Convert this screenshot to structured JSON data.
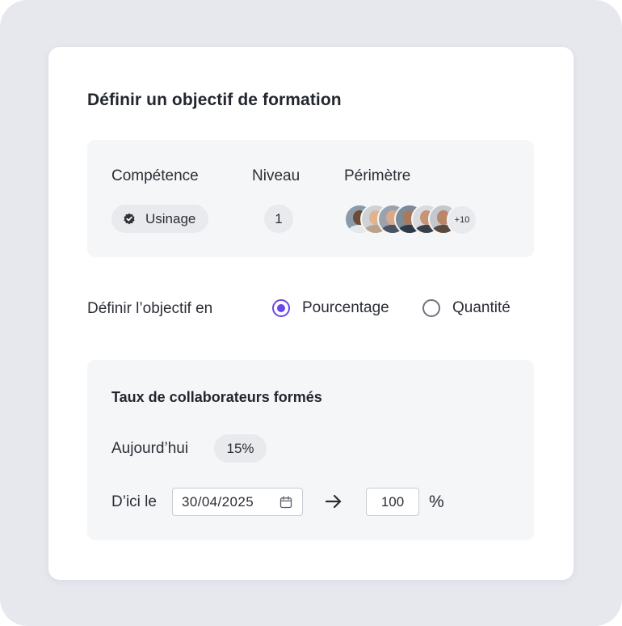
{
  "title": "Définir un objectif de formation",
  "summary": {
    "competence_label": "Compétence",
    "niveau_label": "Niveau",
    "perimetre_label": "Périmètre",
    "competence_value": "Usinage",
    "niveau_value": "1",
    "perimetre_more": "+10"
  },
  "mode": {
    "label": "Définir l’objectif en",
    "options": [
      {
        "label": "Pourcentage",
        "selected": true
      },
      {
        "label": "Quantité",
        "selected": false
      }
    ]
  },
  "target": {
    "title": "Taux de collaborateurs formés",
    "today_label": "Aujourd’hui",
    "today_value": "15%",
    "until_label": "D’ici le",
    "date_value": "30/04/2025",
    "target_value": "100",
    "unit": "%"
  },
  "colors": {
    "accent": "#6b46e8",
    "background": "#e6e8ee",
    "panel": "#f5f6f8",
    "chip": "#e9eaee"
  }
}
